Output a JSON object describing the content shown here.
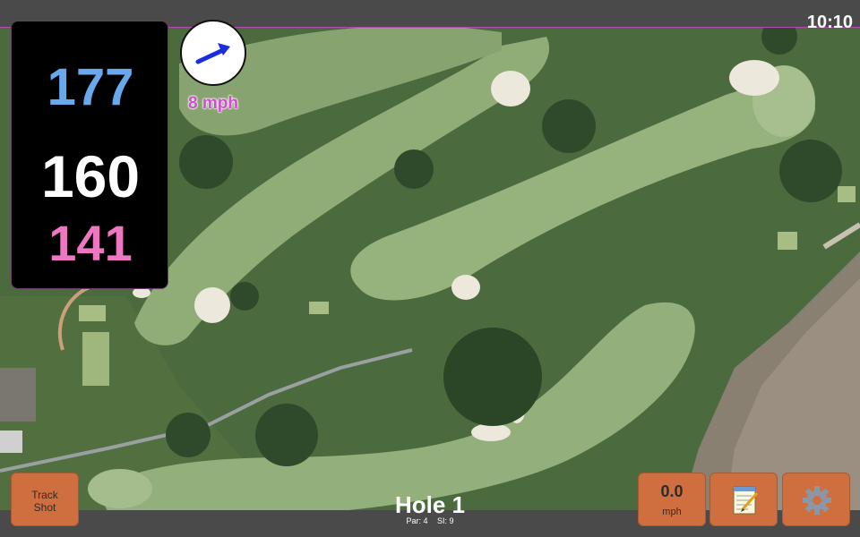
{
  "status": {
    "time": "10:10"
  },
  "distances": {
    "back": "177",
    "middle": "160",
    "front": "141"
  },
  "wind": {
    "speed_label": "8 mph",
    "icon": "wind-arrow-icon",
    "direction": "east-northeast"
  },
  "hole": {
    "title": "Hole 1",
    "par": "Par: 4",
    "stroke_index": "SI: 9"
  },
  "buttons": {
    "track_shot_line1": "Track",
    "track_shot_line2": "Shot",
    "speed_value": "0.0",
    "speed_unit": "mph",
    "notes_icon": "notepad-icon",
    "settings_icon": "gear-icon"
  },
  "colors": {
    "back_distance": "#6aa8ee",
    "middle_distance": "#ffffff",
    "front_distance": "#ee77c2",
    "button_fill": "#cf6f3f",
    "wind_text": "#d14ccf"
  }
}
